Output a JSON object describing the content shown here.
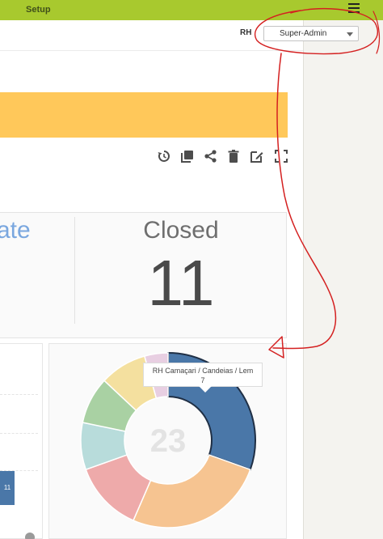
{
  "topbar": {
    "setup_label": "Setup",
    "menu_icon": "hamburger-icon"
  },
  "header": {
    "user_prefix": "RH",
    "role_selected": "Super-Admin"
  },
  "banner": {
    "color": "#ffc85a"
  },
  "toolbar": {
    "icons": [
      "history-icon",
      "copy-icon",
      "share-icon",
      "trash-icon",
      "edit-icon",
      "fullscreen-icon"
    ]
  },
  "stats": {
    "left_partial_label": "ate",
    "closed_label": "Closed",
    "closed_value": "11"
  },
  "bar_chart": {
    "bar_value_label": "11"
  },
  "chart_data": {
    "type": "pie",
    "donut": true,
    "center_label": "23",
    "slices": [
      {
        "label": "RH Camaçari / Candeias / Lem",
        "value": 7,
        "color": "#4a77a8"
      },
      {
        "value": 6,
        "color": "#f6c491"
      },
      {
        "value": 3,
        "color": "#eeaaaa"
      },
      {
        "value": 2,
        "color": "#b8dcdb"
      },
      {
        "value": 2,
        "color": "#a9d1a3"
      },
      {
        "value": 2,
        "color": "#f4e09f"
      },
      {
        "value": 1,
        "color": "#e8cfe2"
      }
    ],
    "tooltip": {
      "label": "RH Camaçari / Candeias / Lem",
      "value": "7"
    }
  },
  "colors": {
    "topbar": "#a8c92e",
    "annotation": "#d42020"
  }
}
